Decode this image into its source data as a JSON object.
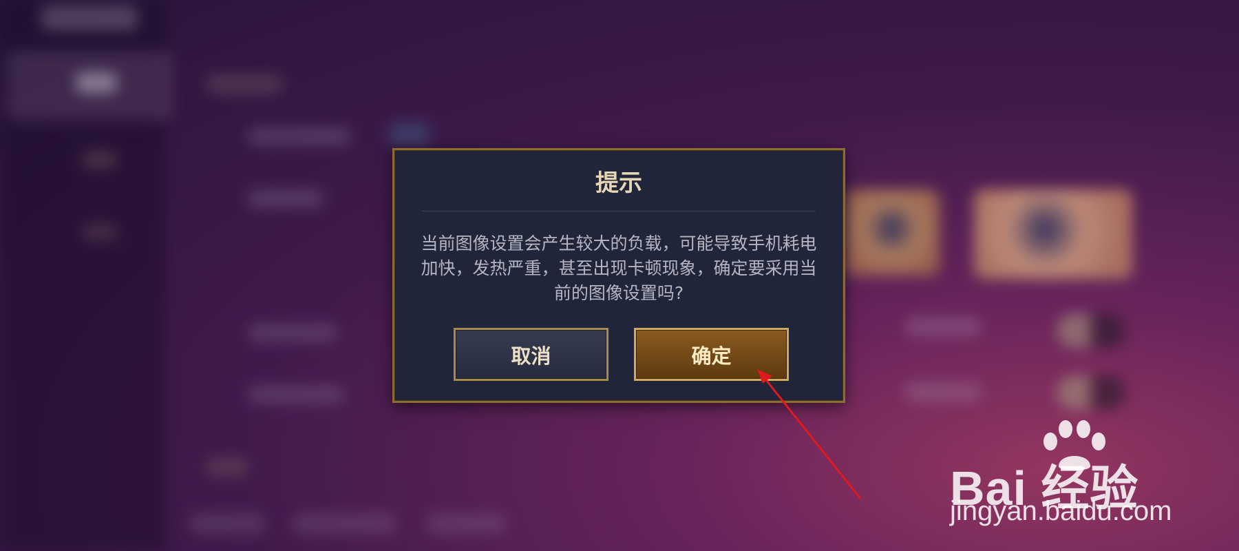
{
  "dialog": {
    "title": "提示",
    "message": "当前图像设置会产生较大的负载，可能导致手机耗电加快，发热严重，甚至出现卡顿现象，确定要采用当前的图像设置吗?",
    "cancel_label": "取消",
    "confirm_label": "确定"
  },
  "watermark": {
    "brand": "Bai 经验",
    "url": "jingyan.baidu.com"
  },
  "colors": {
    "dialog_bg": "#21253a",
    "dialog_border": "#8c6a32",
    "title_text": "#e6d6b6",
    "confirm_bg": "#7a4e1a",
    "annotation_arrow": "#e0191e"
  }
}
